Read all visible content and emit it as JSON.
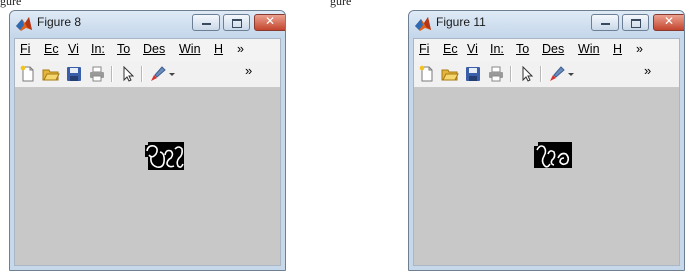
{
  "top_fragment": {
    "left_text": "gure",
    "right_text": "gure"
  },
  "windows": [
    {
      "title": "Figure 8",
      "menus": [
        "Fi",
        "Ec",
        "Vi",
        "In:",
        "To",
        "Des",
        "Win",
        "H",
        "»"
      ],
      "toolbar": [
        "new-file-icon",
        "open-folder-icon",
        "save-disk-icon",
        "print-icon",
        "pointer-arrow-icon",
        "brush-icon"
      ]
    },
    {
      "title": "Figure 11",
      "menus": [
        "Fi",
        "Ec",
        "Vi",
        "In:",
        "To",
        "Des",
        "Win",
        "H",
        "»"
      ],
      "toolbar": [
        "new-file-icon",
        "open-folder-icon",
        "save-disk-icon",
        "print-icon",
        "pointer-arrow-icon",
        "brush-icon"
      ]
    }
  ],
  "colors": {
    "plot_bg": "#c8c8c8",
    "image_bg": "#000000",
    "strokes": "#ffffff",
    "titlebar": "#c7d8ea",
    "close": "#c3452e"
  }
}
